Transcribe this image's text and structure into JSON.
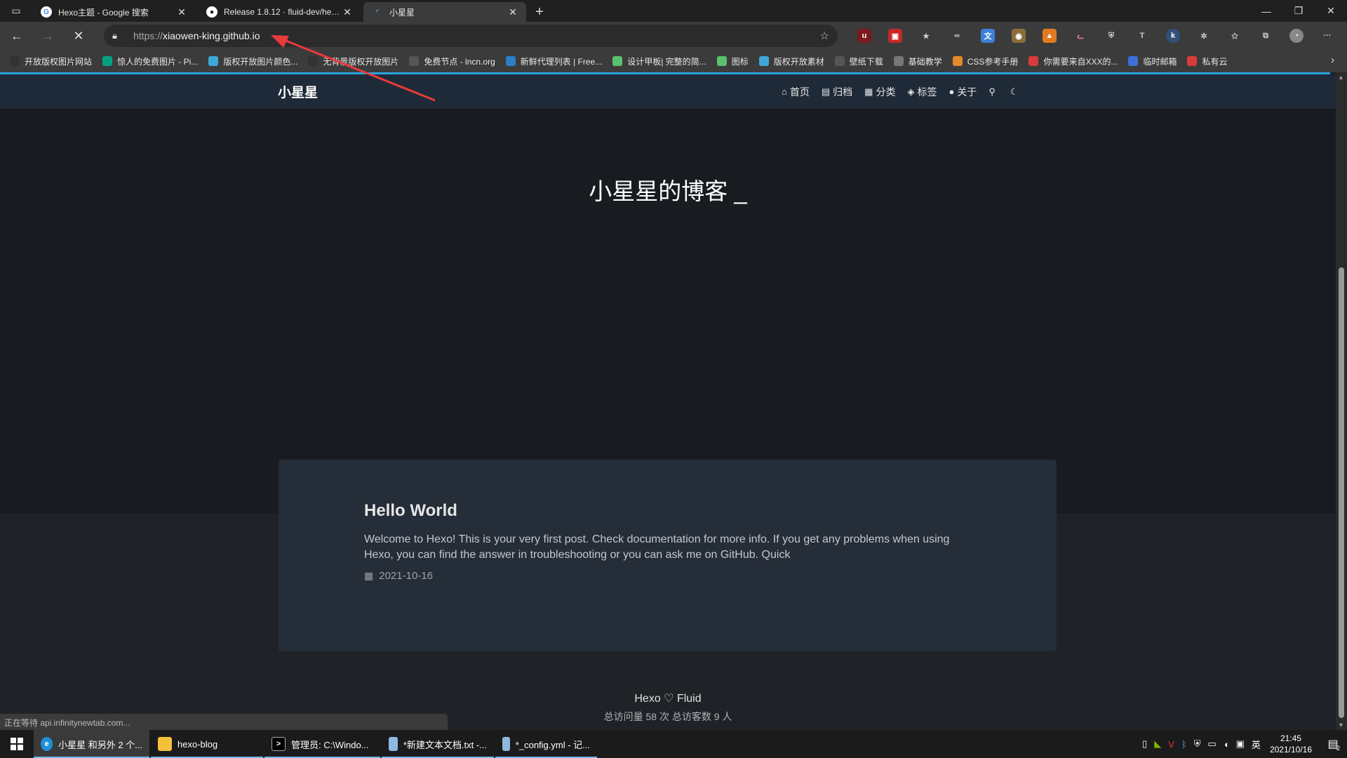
{
  "tabs": [
    {
      "title": "Hexo主题 - Google 搜索",
      "favicon": "google-icon"
    },
    {
      "title": "Release 1.8.12 · fluid-dev/hexo-theme-fluid",
      "favicon": "github-icon"
    },
    {
      "title": "小星星",
      "favicon": "loading-icon"
    }
  ],
  "address": {
    "scheme": "https://",
    "host": "xiaowen-king.github.io"
  },
  "bookmarks": [
    {
      "label": "开放版权图片网站",
      "color": "#333333"
    },
    {
      "label": "惊人的免费图片 - Pi...",
      "color": "#05a081"
    },
    {
      "label": "版权开放图片颜色...",
      "color": "#3ea7d8"
    },
    {
      "label": "无背景版权开放图片",
      "color": "#333333"
    },
    {
      "label": "免费节点 - lncn.org",
      "color": "#555555"
    },
    {
      "label": "新鲜代理列表 | Free...",
      "color": "#2a7fc6"
    },
    {
      "label": "设计甲板| 完整的简...",
      "color": "#59c26d"
    },
    {
      "label": "图标",
      "color": "#59c26d"
    },
    {
      "label": "版权开放素材",
      "color": "#3ea7d8"
    },
    {
      "label": "壁纸下载",
      "color": "#555555"
    },
    {
      "label": "基础教学",
      "color": "#777777"
    },
    {
      "label": "CSS参考手册",
      "color": "#e6892d"
    },
    {
      "label": "你需要来自XXX的...",
      "color": "#d93b3b"
    },
    {
      "label": "临时邮箱",
      "color": "#3d6fd8"
    },
    {
      "label": "私有云",
      "color": "#d93b3b"
    }
  ],
  "site": {
    "brand": "小星星",
    "nav": [
      {
        "label": "首页",
        "icon": "home-icon"
      },
      {
        "label": "归档",
        "icon": "archive-icon"
      },
      {
        "label": "分类",
        "icon": "category-icon"
      },
      {
        "label": "标签",
        "icon": "tag-icon"
      },
      {
        "label": "关于",
        "icon": "user-icon"
      }
    ],
    "banner_title": "小星星的博客 _",
    "post": {
      "title": "Hello World",
      "excerpt": "Welcome to Hexo! This is your very first post. Check documentation for more info. If you get any problems when using Hexo, you can find the answer in troubleshooting or you can ask me on GitHub. Quick",
      "date": "2021-10-16"
    },
    "footer_line1": "Hexo ♡ Fluid",
    "footer_line2": "总访问量 58 次  总访客数 9 人"
  },
  "status_text": "正在等待 api.infinitynewtab.com...",
  "taskbar": [
    {
      "label": "小星星 和另外 2 个...",
      "icon": "edge-icon",
      "active": true
    },
    {
      "label": "hexo-blog",
      "icon": "folder-icon",
      "active": false
    },
    {
      "label": "管理员: C:\\Windo...",
      "icon": "cmd-icon",
      "active": false
    },
    {
      "label": "*新建文本文档.txt -...",
      "icon": "notepad-icon",
      "active": false
    },
    {
      "label": "*_config.yml - 记...",
      "icon": "notepad-icon",
      "active": false
    }
  ],
  "clock": {
    "time": "21:45",
    "date": "2021/10/16"
  },
  "tray_lang": "英",
  "notif_count": "2",
  "colors": {
    "accent": "#29a3e0",
    "annotation": "#e83a3a",
    "nav_bg": "#1f2a38",
    "card_bg": "#252d38"
  }
}
